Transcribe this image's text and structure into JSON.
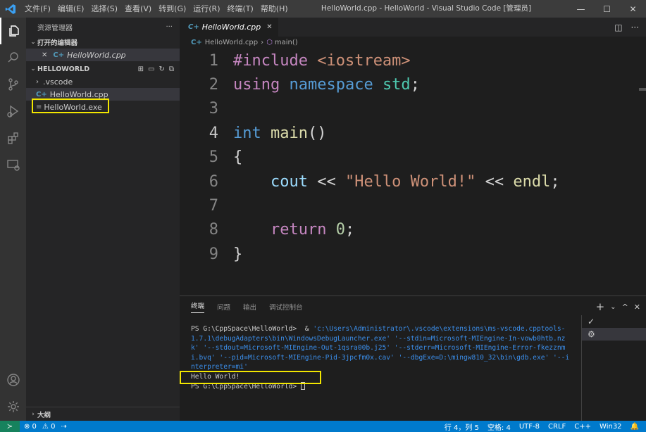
{
  "titlebar": {
    "menus": [
      "文件(F)",
      "编辑(E)",
      "选择(S)",
      "查看(V)",
      "转到(G)",
      "运行(R)",
      "终端(T)",
      "帮助(H)"
    ],
    "window_title": "HelloWorld.cpp - HelloWorld - Visual Studio Code [管理员]",
    "minimize": "—",
    "maximize": "☐",
    "close": "✕"
  },
  "sidebar": {
    "title": "资源管理器",
    "more": "···",
    "open_editors_label": "打开的编辑器",
    "open_editor_file": "HelloWorld.cpp",
    "folder_label": "HELLOWORLD",
    "files": [
      {
        "name": ".vscode",
        "kind": "folder"
      },
      {
        "name": "HelloWorld.cpp",
        "kind": "cpp"
      },
      {
        "name": "HelloWorld.exe",
        "kind": "exe"
      }
    ],
    "outline_label": "大纲"
  },
  "editor": {
    "tab_label": "HelloWorld.cpp",
    "tab_close": "✕",
    "breadcrumb_file": "HelloWorld.cpp",
    "breadcrumb_symbol": "main()",
    "lines": [
      {
        "n": "1",
        "tokens": [
          {
            "t": "#include ",
            "c": "kw"
          },
          {
            "t": "<iostream>",
            "c": "inc"
          }
        ]
      },
      {
        "n": "2",
        "tokens": [
          {
            "t": "using ",
            "c": "kw"
          },
          {
            "t": "namespace ",
            "c": "blue"
          },
          {
            "t": "std",
            "c": "ns"
          },
          {
            "t": ";",
            "c": "pl"
          }
        ]
      },
      {
        "n": "3",
        "tokens": []
      },
      {
        "n": "4",
        "tokens": [
          {
            "t": "int ",
            "c": "blue"
          },
          {
            "t": "main",
            "c": "fn"
          },
          {
            "t": "()",
            "c": "pl"
          }
        ]
      },
      {
        "n": "5",
        "tokens": [
          {
            "t": "{",
            "c": "pl"
          }
        ]
      },
      {
        "n": "6",
        "tokens": [
          {
            "t": "    cout",
            "c": "var"
          },
          {
            "t": " << ",
            "c": "pl"
          },
          {
            "t": "\"Hello World!\"",
            "c": "str"
          },
          {
            "t": " << ",
            "c": "pl"
          },
          {
            "t": "endl",
            "c": "fn"
          },
          {
            "t": ";",
            "c": "pl"
          }
        ]
      },
      {
        "n": "7",
        "tokens": []
      },
      {
        "n": "8",
        "tokens": [
          {
            "t": "    return ",
            "c": "kw"
          },
          {
            "t": "0",
            "c": "num"
          },
          {
            "t": ";",
            "c": "pl"
          }
        ]
      },
      {
        "n": "9",
        "tokens": [
          {
            "t": "}",
            "c": "pl"
          }
        ]
      }
    ],
    "current_line": "4"
  },
  "panel": {
    "tabs": [
      "终端",
      "问题",
      "输出",
      "调试控制台"
    ],
    "prompt": "PS G:\\CppSpace\\HelloWorld>",
    "command_prefix": "& ",
    "command_path": "'c:\\Users\\Administrator\\.vscode\\extensions\\ms-vscode.cpptools-1.7.1\\debugAdapters\\bin\\WindowsDebugLauncher.exe' '--stdin=Microsoft-MIEngine-In-vowb0htb.nzk' '--stdout=Microsoft-MIEngine-Out-1qsra00b.j25' '--stderr=Microsoft-MIEngine-Error-fkezznmi.bvq' '--pid=Microsoft-MIEngine-Pid-3jpcfm0x.cav' '--dbgExe=D:\\mingw810_32\\bin\\gdb.exe' '--interpreter=mi'",
    "output": "Hello World!",
    "prompt2": "PS G:\\CppSpace\\HelloWorld>",
    "add": "+",
    "chevron": "⌄",
    "collapse": "^",
    "close": "✕",
    "term_list": [
      "✓",
      "⚙"
    ]
  },
  "statusbar": {
    "remote": "≻",
    "errors": "⊗ 0",
    "warnings": "⚠ 0",
    "position": "行 4，列 5",
    "spaces": "空格: 4",
    "encoding": "UTF-8",
    "eol": "CRLF",
    "language": "C++",
    "platform": "Win32",
    "bell": "🔔"
  }
}
